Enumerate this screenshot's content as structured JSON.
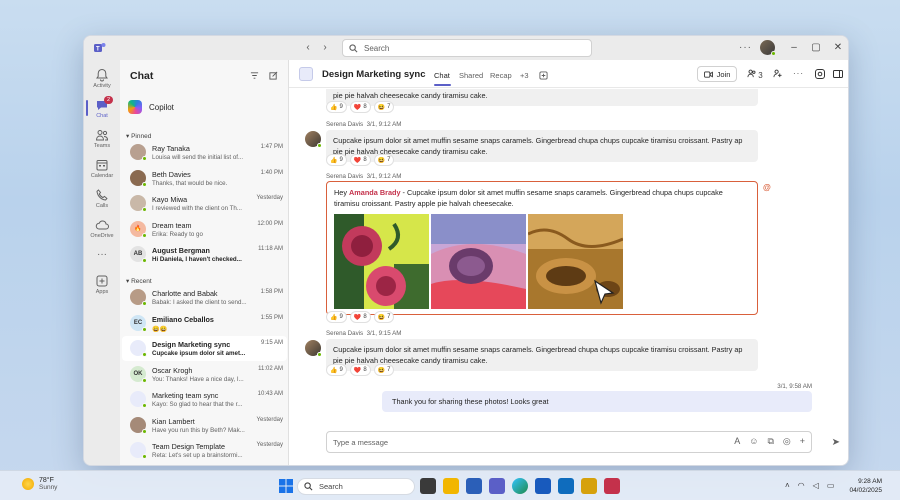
{
  "titlebar": {
    "search_placeholder": "Search",
    "more_label": "···"
  },
  "rail": {
    "items": [
      {
        "label": "Activity",
        "icon": "bell-icon"
      },
      {
        "label": "Chat",
        "icon": "chat-icon",
        "badge": "2"
      },
      {
        "label": "Teams",
        "icon": "teams-icon"
      },
      {
        "label": "Calendar",
        "icon": "calendar-icon"
      },
      {
        "label": "Calls",
        "icon": "phone-icon"
      },
      {
        "label": "OneDrive",
        "icon": "cloud-icon"
      },
      {
        "label": "···",
        "icon": "more-icon"
      },
      {
        "label": "Apps",
        "icon": "add-apps-icon"
      }
    ]
  },
  "chatlist": {
    "title": "Chat",
    "copilot_label": "Copilot",
    "pinned_label": "Pinned",
    "recent_label": "Recent",
    "pinned": [
      {
        "name": "Ray Tanaka",
        "preview": "Louisa will send the initial list of...",
        "time": "1:47 PM",
        "avatar_color": "#b8a090"
      },
      {
        "name": "Beth Davies",
        "preview": "Thanks, that would be nice.",
        "time": "1:40 PM",
        "avatar_color": "#8a6a50"
      },
      {
        "name": "Kayo Miwa",
        "preview": "I reviewed with the client on Th...",
        "time": "Yesterday",
        "avatar_color": "#c9b8a8"
      },
      {
        "name": "Dream team",
        "preview": "Erika: Ready to go",
        "time": "12:00 PM",
        "avatar_color": "#f4b9a0",
        "group_emoji": "🔥"
      },
      {
        "name": "August Bergman",
        "preview": "Hi Daniela, I haven't checked...",
        "time": "11:18 AM",
        "initials": "AB",
        "avatar_color": "#e3e3e3",
        "unread": true
      }
    ],
    "recent": [
      {
        "name": "Charlotte and Babak",
        "preview": "Babak: I asked the client to send...",
        "time": "1:58 PM",
        "avatar_color": "#b79b86"
      },
      {
        "name": "Emiliano Ceballos",
        "preview": "😄😄",
        "time": "1:55 PM",
        "initials": "EC",
        "avatar_color": "#cfe6f5",
        "unread": true
      },
      {
        "name": "Design Marketing sync",
        "preview": "Cupcake ipsum dolor sit amet...",
        "time": "9:15 AM",
        "avatar_color": "#e8ebfa",
        "unread": true,
        "selected": true
      },
      {
        "name": "Oscar Krogh",
        "preview": "You: Thanks! Have a nice day, I...",
        "time": "11:02 AM",
        "initials": "OK",
        "avatar_color": "#d5ead0"
      },
      {
        "name": "Marketing team sync",
        "preview": "Kayo: So glad to hear that the r...",
        "time": "10:43 AM",
        "avatar_color": "#e8ebfa"
      },
      {
        "name": "Kian Lambert",
        "preview": "Have you run this by Beth? Mak...",
        "time": "Yesterday",
        "avatar_color": "#a58a78"
      },
      {
        "name": "Team Design Template",
        "preview": "Reta: Let's set up a brainstormi...",
        "time": "Yesterday",
        "avatar_color": "#e8ebfa"
      }
    ]
  },
  "main": {
    "title": "Design Marketing sync",
    "tabs": [
      "Chat",
      "Shared",
      "Recap",
      "+3"
    ],
    "join_label": "Join",
    "participants_count": "3",
    "messages": [
      {
        "text": "pie pie halvah cheesecake candy tiramisu cake.",
        "reactions": [
          {
            "emoji": "👍",
            "count": "9"
          },
          {
            "emoji": "❤️",
            "count": "8"
          },
          {
            "emoji": "😆",
            "count": "7"
          }
        ]
      },
      {
        "sender": "Serena Davis",
        "time": "3/1, 9:12 AM",
        "text": "Cupcake ipsum dolor sit amet muffin sesame snaps caramels. Gingerbread chupa chups cupcake tiramisu croissant. Pastry ap pie pie halvah cheesecake candy tiramisu cake.",
        "reactions": [
          {
            "emoji": "👍",
            "count": "9"
          },
          {
            "emoji": "❤️",
            "count": "8"
          },
          {
            "emoji": "😆",
            "count": "7"
          }
        ]
      },
      {
        "sender": "Serena Davis",
        "time": "3/1, 9:12 AM",
        "greeting": "Hey",
        "mention": "Amanda Brady",
        "text": "- Cupcake ipsum dolor sit amet muffin sesame snaps caramels. Gingerbread chupa chups cupcake tiramisu croissant. Pastry apple pie halvah cheesecake.",
        "reactions": [
          {
            "emoji": "👍",
            "count": "9"
          },
          {
            "emoji": "❤️",
            "count": "8"
          },
          {
            "emoji": "😆",
            "count": "7"
          }
        ]
      },
      {
        "sender": "Serena Davis",
        "time": "3/1, 9:15 AM",
        "text": "Cupcake ipsum dolor sit amet muffin sesame snaps caramels. Gingerbread chupa chups cupcake tiramisu croissant. Pastry ap pie pie halvah cheesecake candy tiramisu cake.",
        "reactions": [
          {
            "emoji": "👍",
            "count": "9"
          },
          {
            "emoji": "❤️",
            "count": "8"
          },
          {
            "emoji": "😆",
            "count": "7"
          }
        ]
      }
    ],
    "own_message": {
      "time": "3/1, 9:58 AM",
      "text": "Thank you for sharing these photos! Looks great"
    },
    "composer_placeholder": "Type a message"
  },
  "taskbar": {
    "weather_temp": "78°F",
    "weather_desc": "Sunny",
    "search_label": "Search",
    "time": "9:28 AM",
    "date": "04/02/2025"
  },
  "colors": {
    "brand": "#5b5fc7",
    "mention": "#c4314b",
    "highlight_border": "#d9603b",
    "online": "#6bb700"
  }
}
